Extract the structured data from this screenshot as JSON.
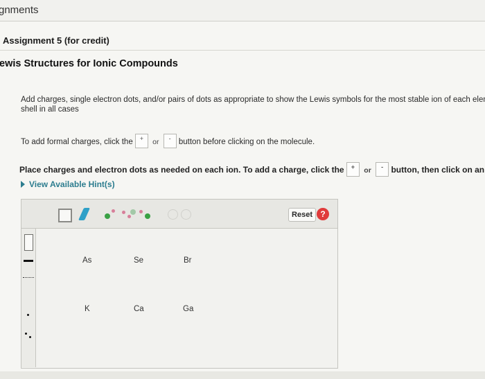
{
  "header": {
    "title": "gnments"
  },
  "assignment": {
    "title": "Assignment 5 (for credit)"
  },
  "problem": {
    "title": "ewis Structures for Ionic Compounds"
  },
  "instructions": {
    "line1": "Add charges, single electron dots, and/or pairs of dots as appropriate to show the Lewis symbols for the most stable ion of each elem",
    "line1b": "shell in all cases",
    "formal_prefix": "To add formal charges, click the",
    "or": "or",
    "formal_suffix": "button before clicking on the molecule.",
    "place_prefix": "Place charges and electron dots as needed on each ion. To add a charge, click the",
    "place_suffix": "button, then click on an ator",
    "plus": "+",
    "minus": "-"
  },
  "hints": {
    "label": "View Available Hint(s)"
  },
  "toolbar": {
    "reset_label": "Reset",
    "help_label": "?",
    "icons": [
      "select-icon",
      "pencil-icon",
      "single-electron-icon",
      "electron-pair-icon",
      "remove-electron-icon",
      "undo-icon",
      "redo-icon"
    ]
  },
  "elements": {
    "row1": [
      "As",
      "Se",
      "Br"
    ],
    "row2": [
      "K",
      "Ca",
      "Ga"
    ]
  },
  "colors": {
    "hint": "#2d7d8f",
    "help": "#e03b3b",
    "pencil": "#2fa0c8",
    "electron": "#3aa145"
  }
}
